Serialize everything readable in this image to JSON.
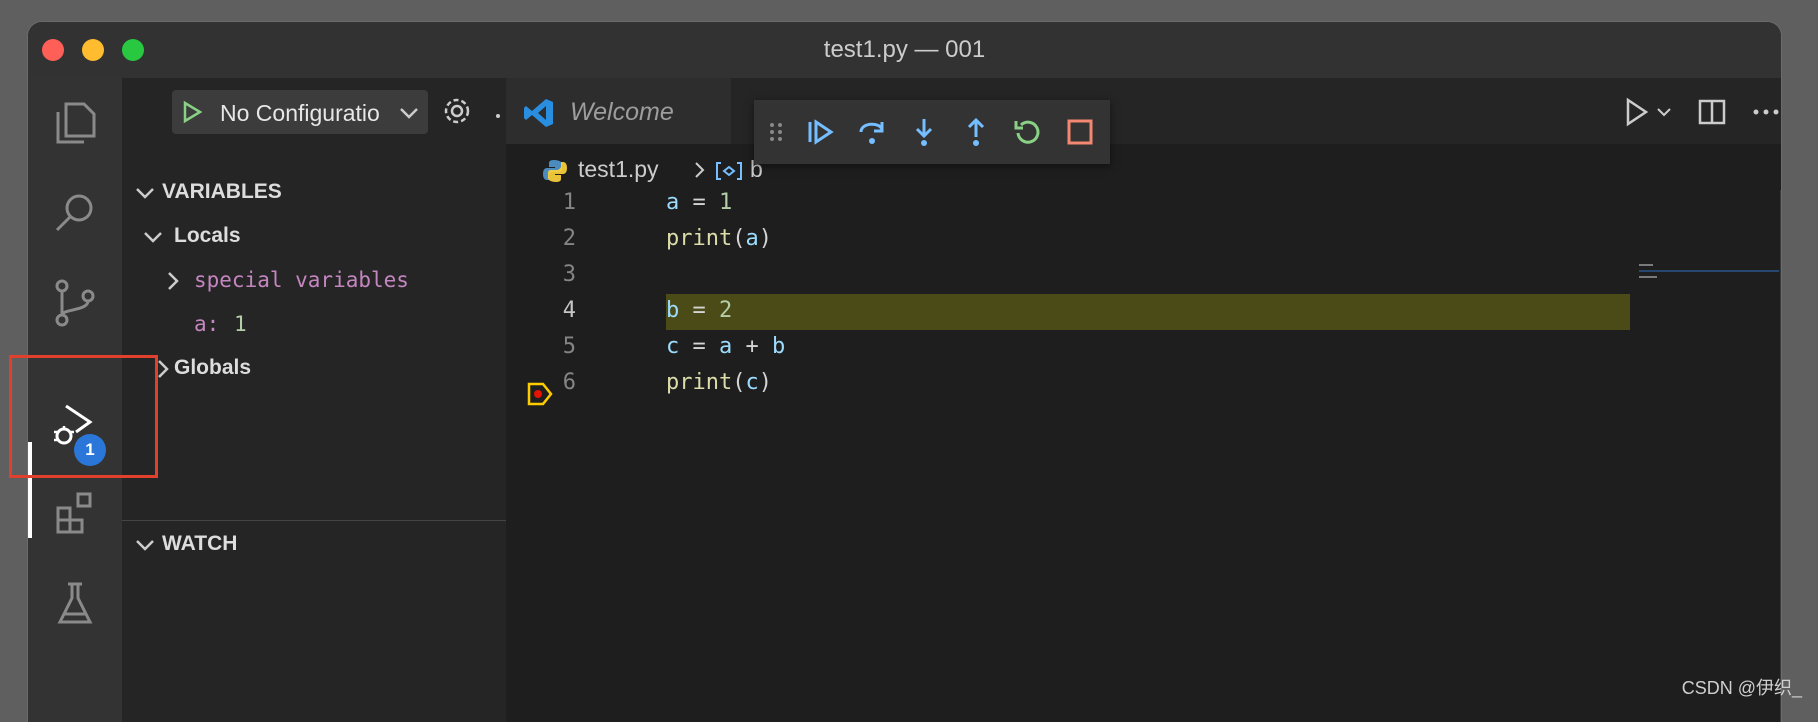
{
  "window": {
    "title": "test1.py — 001"
  },
  "activity_bar": {
    "items": [
      "explorer-icon",
      "search-icon",
      "source-control-icon",
      "run-debug-icon",
      "extensions-icon",
      "testing-icon"
    ],
    "debug_badge": "1"
  },
  "sidebar": {
    "run_config_label": "No Configuratio",
    "variables_header": "VARIABLES",
    "locals_label": "Locals",
    "special_variables_label": "special variables",
    "local_var": {
      "name": "a:",
      "value": "1"
    },
    "globals_label": "Globals",
    "watch_header": "WATCH"
  },
  "editor": {
    "tab_label": "Welcome",
    "breadcrumb": {
      "file": "test1.py",
      "symbol": "b"
    },
    "lines": [
      {
        "num": "1"
      },
      {
        "num": "2"
      },
      {
        "num": "3"
      },
      {
        "num": "4"
      },
      {
        "num": "5"
      },
      {
        "num": "6"
      }
    ],
    "current_line": "4"
  },
  "debug_toolbar": [
    "drag-handle-icon",
    "continue-icon",
    "step-over-icon",
    "step-into-icon",
    "step-out-icon",
    "restart-icon",
    "stop-icon"
  ],
  "colors": {
    "accent": "#2a77d9",
    "highlight_box": "#e0402c",
    "current_line_bg": "#4b4b18",
    "debug_blue": "#75beff",
    "restart_green": "#89d185",
    "stop_red": "#f48771"
  },
  "watermark": "CSDN @伊织_"
}
